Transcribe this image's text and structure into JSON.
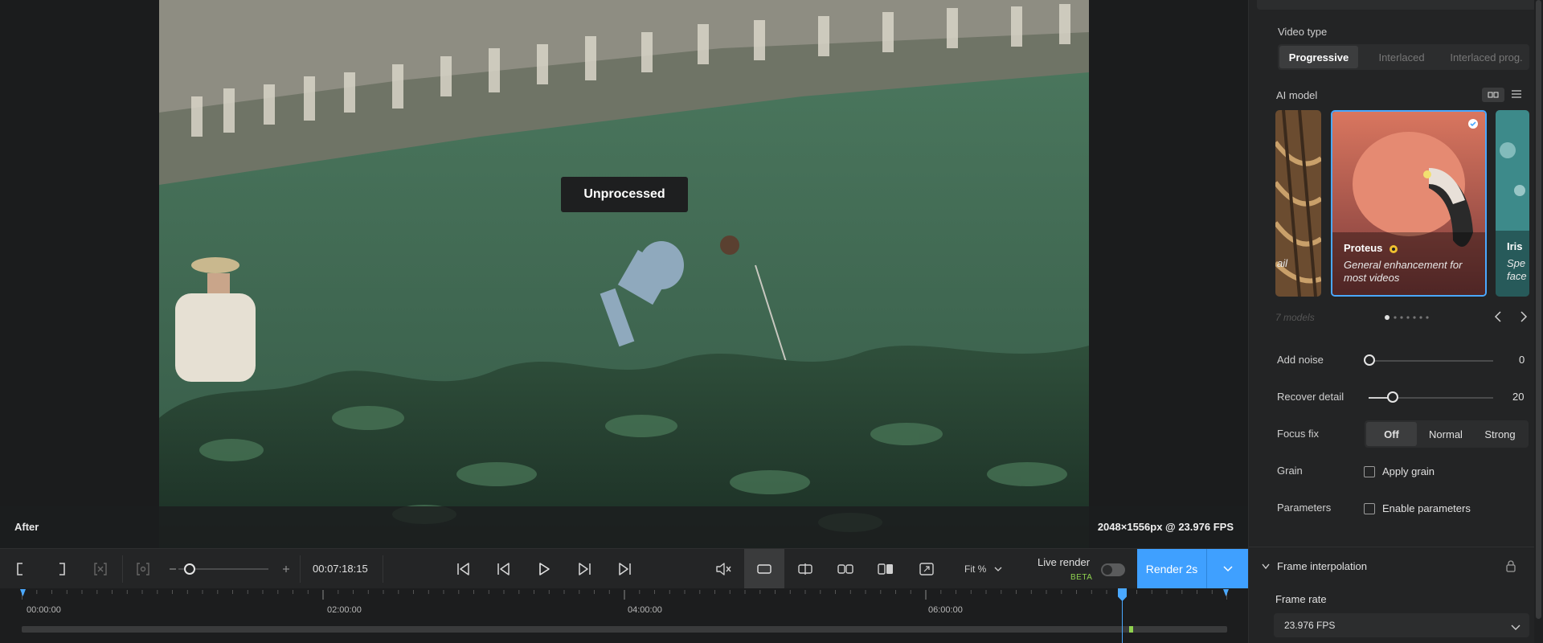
{
  "preview": {
    "badge": "Unprocessed",
    "view_label": "After",
    "resolution": "2048×1556px @ 23.976 FPS"
  },
  "transport": {
    "timecode": "00:07:18:15",
    "fit": "Fit %",
    "live_render": "Live render",
    "beta": "BETA",
    "render_button": "Render 2s"
  },
  "timeline": {
    "labels": [
      "00:00:00",
      "02:00:00",
      "04:00:00",
      "06:00:00"
    ]
  },
  "panel": {
    "video_type": {
      "label": "Video type",
      "options": [
        "Progressive",
        "Interlaced",
        "Interlaced prog."
      ],
      "selected": "Progressive"
    },
    "ai_model": {
      "label": "AI model",
      "cards": [
        {
          "title": "",
          "desc": "ail"
        },
        {
          "title": "Proteus",
          "desc": "General enhancement for most videos",
          "selected": true
        },
        {
          "title": "Iris",
          "desc": "Spe face"
        }
      ],
      "count": "7 models"
    },
    "add_noise": {
      "label": "Add noise",
      "value": "0"
    },
    "recover_detail": {
      "label": "Recover detail",
      "value": "20"
    },
    "focus_fix": {
      "label": "Focus fix",
      "options": [
        "Off",
        "Normal",
        "Strong"
      ],
      "selected": "Off"
    },
    "grain": {
      "label": "Grain",
      "checkbox": "Apply grain"
    },
    "parameters": {
      "label": "Parameters",
      "checkbox": "Enable parameters"
    },
    "frame_interpolation": {
      "label": "Frame interpolation"
    },
    "frame_rate": {
      "label": "Frame rate",
      "value": "23.976 FPS"
    }
  },
  "colors": {
    "accent": "#3fa0ff",
    "beta": "#8fd14f"
  }
}
